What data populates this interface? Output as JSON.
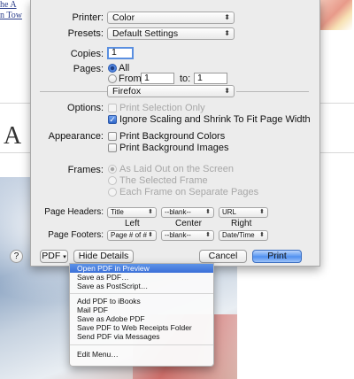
{
  "background": {
    "link_lines": [
      "he A",
      "n Tow"
    ],
    "big_letter": "A"
  },
  "print": {
    "printer": {
      "label": "Printer:",
      "value": "Color"
    },
    "presets": {
      "label": "Presets:",
      "value": "Default Settings"
    },
    "copies": {
      "label": "Copies:",
      "value": "1"
    },
    "pages": {
      "label": "Pages:",
      "all_label": "All",
      "from_label": "From:",
      "from_value": "1",
      "to_label": "to:",
      "to_value": "1",
      "selected": "All"
    },
    "app_section": "Firefox",
    "options": {
      "label": "Options:",
      "items": [
        {
          "label": "Print Selection Only",
          "checked": false,
          "enabled": false
        },
        {
          "label": "Ignore Scaling and Shrink To Fit Page Width",
          "checked": true,
          "enabled": true
        }
      ]
    },
    "appearance": {
      "label": "Appearance:",
      "items": [
        {
          "label": "Print Background Colors",
          "checked": false
        },
        {
          "label": "Print Background Images",
          "checked": false
        }
      ]
    },
    "frames": {
      "label": "Frames:",
      "items": [
        {
          "label": "As Laid Out on the Screen",
          "selected": true
        },
        {
          "label": "The Selected Frame",
          "selected": false
        },
        {
          "label": "Each Frame on Separate Pages",
          "selected": false
        }
      ]
    },
    "headers": {
      "label": "Page Headers:",
      "left": "Title",
      "center": "--blank--",
      "right": "URL"
    },
    "column_labels": {
      "left": "Left",
      "center": "Center",
      "right": "Right"
    },
    "footers": {
      "label": "Page Footers:",
      "left": "Page # of #",
      "center": "--blank--",
      "right": "Date/Time"
    },
    "buttons": {
      "help": "?",
      "pdf": "PDF",
      "hide_details": "Hide Details",
      "cancel": "Cancel",
      "print": "Print"
    }
  },
  "pdf_menu": {
    "items": [
      "Open PDF in Preview",
      "Save as PDF…",
      "Save as PostScript…",
      "Add PDF to iBooks",
      "Mail PDF",
      "Save as Adobe PDF",
      "Save PDF to Web Receipts Folder",
      "Send PDF via Messages",
      "Edit Menu…"
    ],
    "highlighted": "Open PDF in Preview"
  },
  "colors": {
    "accent": "#3a6fd8",
    "sheet": "#ececec"
  }
}
